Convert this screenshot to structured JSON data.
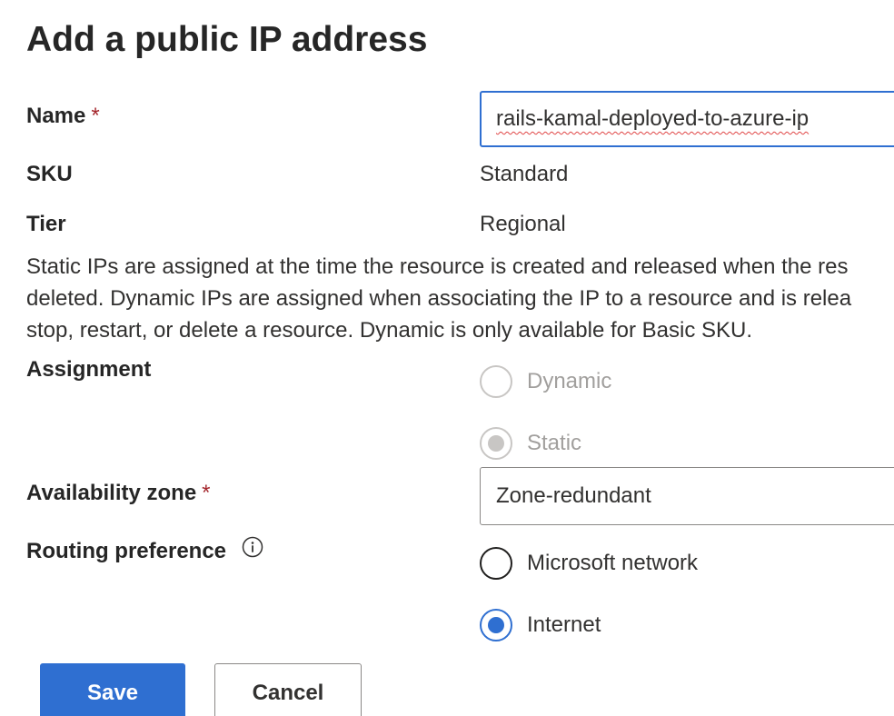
{
  "dialog": {
    "title": "Add a public IP address"
  },
  "fields": {
    "name": {
      "label": "Name",
      "required_marker": "*",
      "value": "rails-kamal-deployed-to-azure-ip"
    },
    "sku": {
      "label": "SKU",
      "value": "Standard"
    },
    "tier": {
      "label": "Tier",
      "value": "Regional"
    },
    "assignment_help": [
      "Static IPs are assigned at the time the resource is created and released when the res",
      "deleted. Dynamic IPs are assigned when associating the IP to a resource and is relea",
      "stop, restart, or delete a resource. Dynamic is only available for Basic SKU."
    ],
    "assignment": {
      "label": "Assignment",
      "options": [
        {
          "label": "Dynamic",
          "selected": false,
          "disabled": true
        },
        {
          "label": "Static",
          "selected": true,
          "disabled": true
        }
      ]
    },
    "availability_zone": {
      "label": "Availability zone",
      "required_marker": "*",
      "value": "Zone-redundant"
    },
    "routing_preference": {
      "label": "Routing preference",
      "info_icon": "info-icon",
      "options": [
        {
          "label": "Microsoft network",
          "selected": false,
          "disabled": false
        },
        {
          "label": "Internet",
          "selected": true,
          "disabled": false
        }
      ]
    }
  },
  "buttons": {
    "save_label": "Save",
    "cancel_label": "Cancel"
  },
  "colors": {
    "accent": "#2f6fd1",
    "required": "#a4262c",
    "disabled": "#c8c6c4"
  }
}
